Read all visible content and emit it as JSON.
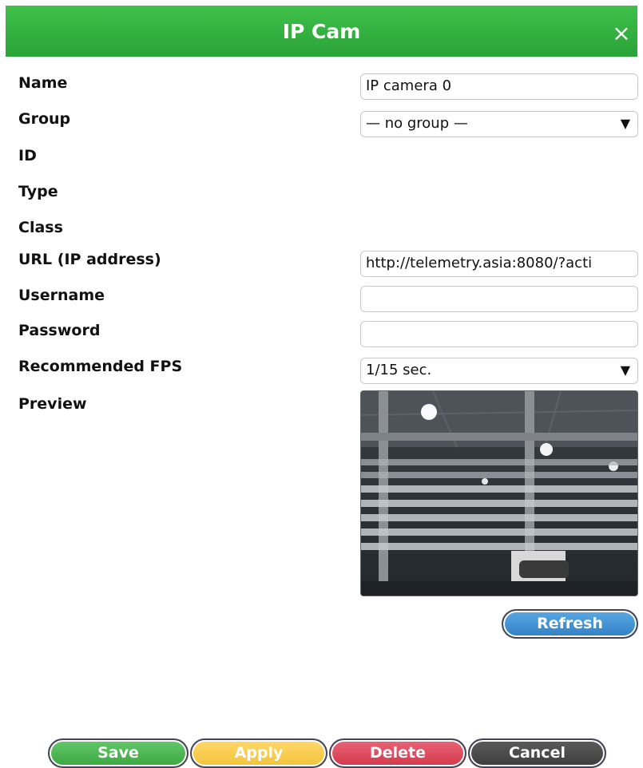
{
  "dialog": {
    "title": "IP Cam",
    "close_icon": "×"
  },
  "fields": {
    "name_label": "Name",
    "name_value": "IP camera 0",
    "group_label": "Group",
    "group_value": "— no group —",
    "id_label": "ID",
    "type_label": "Type",
    "class_label": "Class",
    "url_label": "URL (IP address)",
    "url_value": "http://telemetry.asia:8080/?acti",
    "username_label": "Username",
    "username_value": "",
    "password_label": "Password",
    "password_value": "",
    "fps_label": "Recommended FPS",
    "fps_value": "1/15 sec.",
    "preview_label": "Preview"
  },
  "icons": {
    "dropdown_arrow": "▼"
  },
  "buttons": {
    "refresh": "Refresh",
    "save": "Save",
    "apply": "Apply",
    "delete": "Delete",
    "cancel": "Cancel"
  },
  "colors": {
    "header": "#2aa337",
    "save": "#3aa83f",
    "apply": "#f2c43a",
    "delete": "#d2394b",
    "cancel": "#3c3c3c",
    "refresh": "#2f7fc4"
  }
}
